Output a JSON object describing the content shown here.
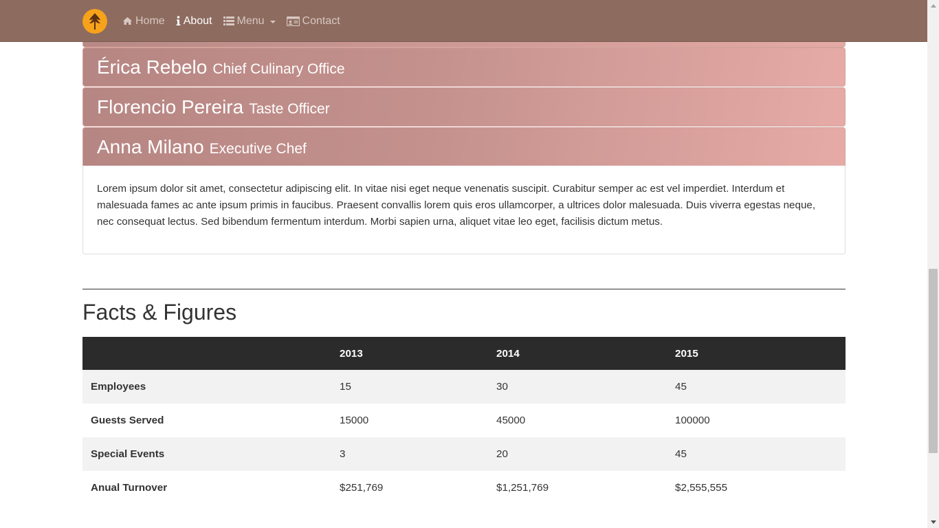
{
  "nav": {
    "items": [
      {
        "label": "Home",
        "icon": "home-icon",
        "active": false
      },
      {
        "label": "About",
        "icon": "info-icon",
        "active": true
      },
      {
        "label": "Menu",
        "icon": "list-icon",
        "active": false,
        "dropdown": true
      },
      {
        "label": "Contact",
        "icon": "contact-card-icon",
        "active": false
      }
    ],
    "logo_icon": "leaf-logo-icon"
  },
  "team": [
    {
      "name": "Érica Rebelo",
      "role": "Chief Culinary Office"
    },
    {
      "name": "Florencio Pereira",
      "role": "Taste Officer"
    },
    {
      "name": "Anna Milano",
      "role": "Executive Chef"
    }
  ],
  "open_panel_text": "Lorem ipsum dolor sit amet, consectetur adipiscing elit. In vitae nisi eget neque venenatis suscipit. Curabitur semper ac est vel imperdiet. Interdum et malesuada fames ac ante ipsum primis in faucibus. Praesent convallis lorem quis eros ullamcorper, a ultrices dolor malesuada. Duis viverra egestas neque, nec consequat lectus. Sed bibendum fermentum interdum. Morbi sapien urna, aliquet vitae leo eget, facilisis dictum metus.",
  "facts": {
    "title": "Facts & Figures",
    "headers": [
      "",
      "2013",
      "2014",
      "2015"
    ],
    "rows": [
      [
        "Employees",
        "15",
        "30",
        "45"
      ],
      [
        "Guests Served",
        "15000",
        "45000",
        "100000"
      ],
      [
        "Special Events",
        "3",
        "20",
        "45"
      ],
      [
        "Anual Turnover",
        "$251,769",
        "$1,251,769",
        "$2,555,555"
      ]
    ]
  },
  "colors": {
    "navbar": "#8d6b5f",
    "logo": "#f6a21b",
    "panel_gradient_start": "#b68683",
    "panel_gradient_end": "#e6aba6",
    "table_header": "#2b2b2b"
  }
}
